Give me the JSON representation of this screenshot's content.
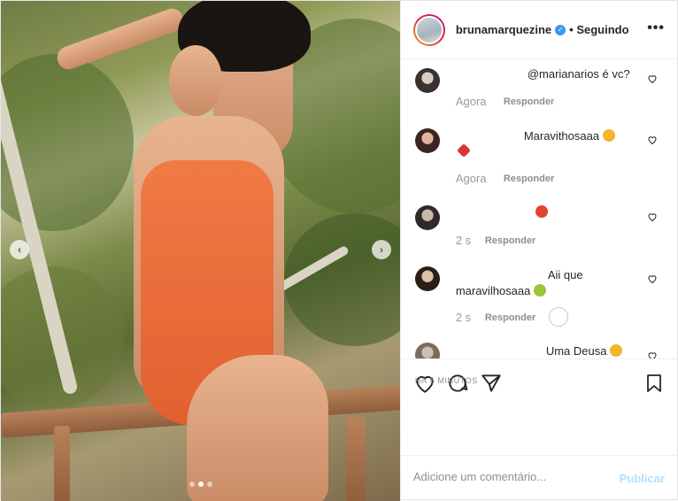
{
  "post": {
    "author": "brunamarquezine",
    "follow_status": "Seguindo",
    "more_icon": "more-dots-icon",
    "carousel": {
      "slides": 3,
      "active_index": 1
    }
  },
  "comments": [
    {
      "text": "@marianarios é vc?",
      "time": "Agora",
      "reply": "Responder"
    },
    {
      "text": "Maravithosaaa",
      "time": "Agora",
      "reply": "Responder"
    },
    {
      "text": "",
      "time": "2 s",
      "reply": "Responder"
    },
    {
      "text_line1": "Aii que",
      "text_line2": "maravilhosaaa",
      "time": "2 s",
      "reply": "Responder"
    },
    {
      "text": "Uma Deusa"
    }
  ],
  "posted_ago": "HÁ 5 MINUTOS",
  "comment_box": {
    "placeholder": "Adicione um comentário...",
    "publish": "Publicar"
  },
  "colors": {
    "accent": "#3897f0",
    "publish_disabled": "#b2dffc",
    "meta": "#8e8e8e",
    "suit": "#f07a45"
  }
}
